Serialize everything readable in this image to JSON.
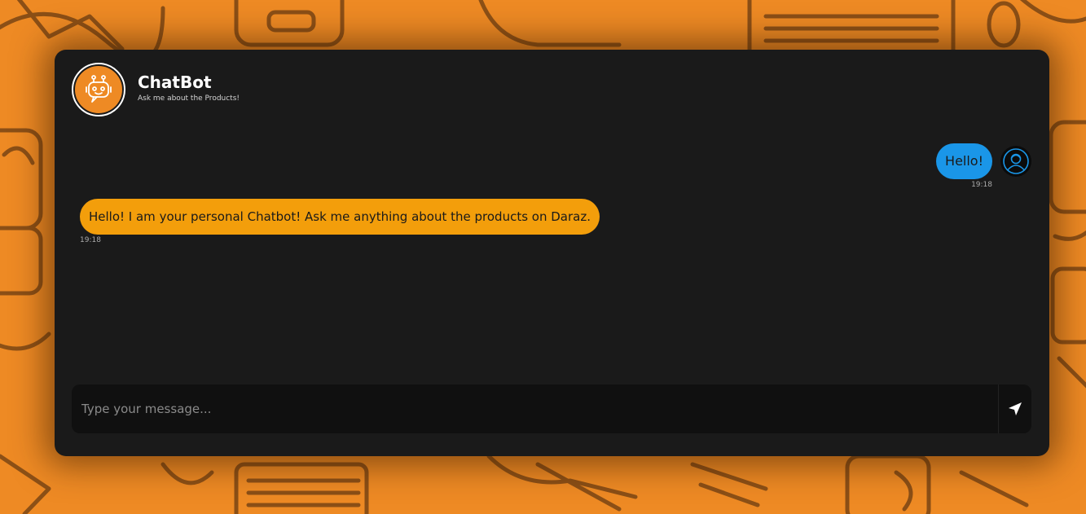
{
  "colors": {
    "background": "#ee8a24",
    "panel": "#1a1a1a",
    "user_bubble": "#1a96e8",
    "bot_bubble": "#f39e0b"
  },
  "header": {
    "avatar_icon": "robot-icon",
    "title": "ChatBot",
    "subtitle": "Ask me about the Products!"
  },
  "messages": [
    {
      "sender": "user",
      "text": "Hello!",
      "time": "19:18",
      "avatar_icon": "user-avatar-icon"
    },
    {
      "sender": "bot",
      "text": "Hello! I am your personal Chatbot! Ask me anything about the products on Daraz.",
      "time": "19:18"
    }
  ],
  "composer": {
    "placeholder": "Type your message...",
    "send_icon": "send-arrow-icon"
  }
}
